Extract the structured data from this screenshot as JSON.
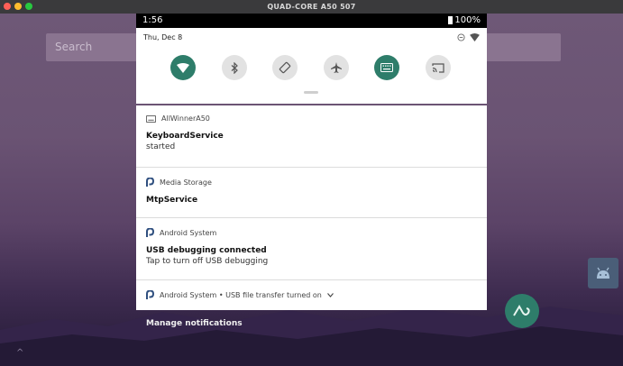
{
  "window": {
    "title": "QUAD-CORE A50 507"
  },
  "home": {
    "search_placeholder": "Search"
  },
  "statusbar": {
    "time": "1:56",
    "battery": "100%"
  },
  "quick_settings": {
    "date": "Thu, Dec 8",
    "tiles": [
      {
        "icon": "wifi-icon",
        "active": true
      },
      {
        "icon": "bluetooth-icon",
        "active": false
      },
      {
        "icon": "auto-rotate-icon",
        "active": false
      },
      {
        "icon": "airplane-mode-icon",
        "active": false
      },
      {
        "icon": "keyboard-icon",
        "active": true
      },
      {
        "icon": "cast-icon",
        "active": false
      }
    ]
  },
  "notifications": [
    {
      "app": "AllWinnerA50",
      "icon": "keyboard-icon",
      "title": "KeyboardService",
      "text": "started"
    },
    {
      "app": "Media Storage",
      "icon": "android-system-icon",
      "title": "MtpService",
      "text": ""
    },
    {
      "app": "Android System",
      "icon": "android-system-icon",
      "title": "USB debugging connected",
      "text": "Tap to turn off USB debugging"
    },
    {
      "app": "Android System • USB file transfer turned on",
      "icon": "android-system-icon",
      "collapsed": true
    }
  ],
  "footer": {
    "manage": "Manage notifications"
  },
  "colors": {
    "accent": "#2e7d6a",
    "statusbar": "#000000"
  }
}
